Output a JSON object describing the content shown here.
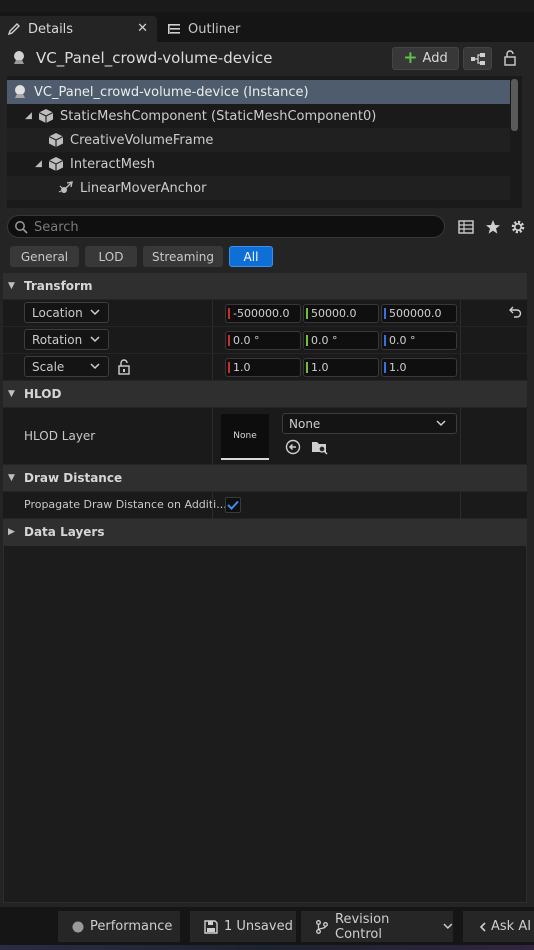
{
  "tabs": [
    {
      "label": "Details",
      "icon": "pencil-icon",
      "active": true
    },
    {
      "label": "Outliner",
      "icon": "list-icon",
      "active": false
    }
  ],
  "header": {
    "actor_name": "VC_Panel_crowd-volume-device",
    "add_label": "Add"
  },
  "tree": {
    "items": [
      {
        "label": "VC_Panel_crowd-volume-device (Instance)",
        "icon": "actor-icon",
        "selected": true
      },
      {
        "label": "StaticMeshComponent (StaticMeshComponent0)",
        "icon": "static-mesh-icon",
        "expanded": true
      },
      {
        "label": "CreativeVolumeFrame",
        "icon": "static-mesh-icon"
      },
      {
        "label": "InteractMesh",
        "icon": "static-mesh-icon",
        "expanded": true
      },
      {
        "label": "LinearMoverAnchor",
        "icon": "scene-component-icon"
      }
    ]
  },
  "search": {
    "placeholder": "Search",
    "value": ""
  },
  "filters": [
    {
      "label": "General",
      "active": false
    },
    {
      "label": "LOD",
      "active": false
    },
    {
      "label": "Streaming",
      "active": false
    },
    {
      "label": "All",
      "active": true
    }
  ],
  "transform": {
    "title": "Transform",
    "location": {
      "label": "Location",
      "x": "-500000.0",
      "y": "50000.0",
      "z": "500000.0"
    },
    "rotation": {
      "label": "Rotation",
      "x": "0.0 °",
      "y": "0.0 °",
      "z": "0.0 °"
    },
    "scale": {
      "label": "Scale",
      "x": "1.0",
      "y": "1.0",
      "z": "1.0"
    }
  },
  "hlod": {
    "title": "HLOD",
    "layer_label": "HLOD Layer",
    "thumbnail_text": "None",
    "dropdown_value": "None"
  },
  "draw_distance": {
    "title": "Draw Distance",
    "propagate_label": "Propagate Draw Distance on Additi...",
    "propagate_checked": true
  },
  "data_layers": {
    "title": "Data Layers"
  },
  "statusbar": {
    "performance": "Performance",
    "unsaved": "1 Unsaved",
    "revision": "Revision Control",
    "ask_ai": "Ask AI"
  },
  "colors": {
    "accent": "#0e6fd6",
    "axis_x": "#c8312b",
    "axis_y": "#6fbf3a",
    "axis_z": "#3a6fe0",
    "add_plus": "#5cc24a"
  }
}
